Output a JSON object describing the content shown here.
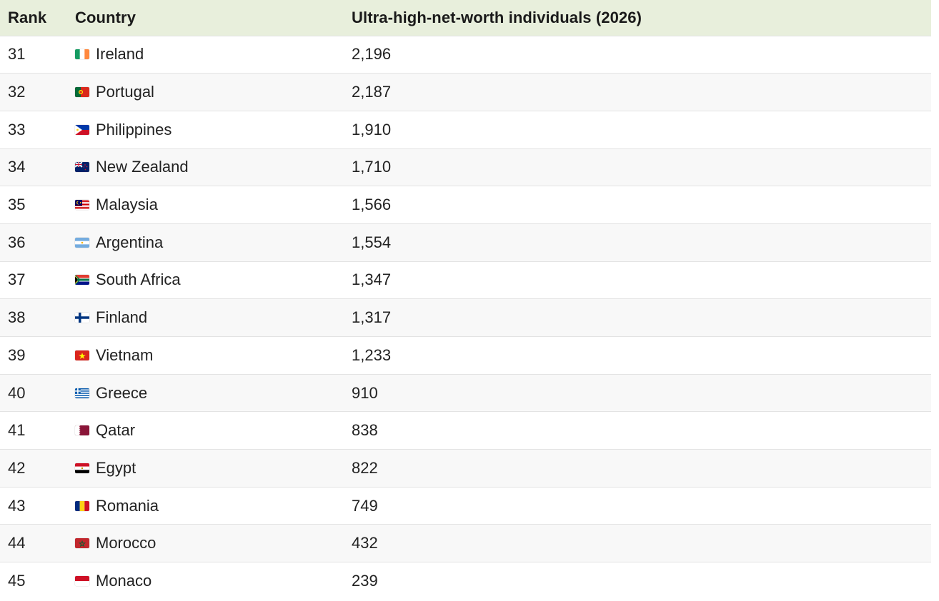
{
  "table": {
    "headers": {
      "rank": "Rank",
      "country": "Country",
      "value": "Ultra-high-net-worth individuals (2026)"
    },
    "rows": [
      {
        "rank": "31",
        "country": "Ireland",
        "value": "2,196",
        "flag_icon": "ireland-flag-icon"
      },
      {
        "rank": "32",
        "country": "Portugal",
        "value": "2,187",
        "flag_icon": "portugal-flag-icon"
      },
      {
        "rank": "33",
        "country": "Philippines",
        "value": "1,910",
        "flag_icon": "philippines-flag-icon"
      },
      {
        "rank": "34",
        "country": "New Zealand",
        "value": "1,710",
        "flag_icon": "new-zealand-flag-icon"
      },
      {
        "rank": "35",
        "country": "Malaysia",
        "value": "1,566",
        "flag_icon": "malaysia-flag-icon"
      },
      {
        "rank": "36",
        "country": "Argentina",
        "value": "1,554",
        "flag_icon": "argentina-flag-icon"
      },
      {
        "rank": "37",
        "country": "South Africa",
        "value": "1,347",
        "flag_icon": "south-africa-flag-icon"
      },
      {
        "rank": "38",
        "country": "Finland",
        "value": "1,317",
        "flag_icon": "finland-flag-icon"
      },
      {
        "rank": "39",
        "country": "Vietnam",
        "value": "1,233",
        "flag_icon": "vietnam-flag-icon"
      },
      {
        "rank": "40",
        "country": "Greece",
        "value": "910",
        "flag_icon": "greece-flag-icon"
      },
      {
        "rank": "41",
        "country": "Qatar",
        "value": "838",
        "flag_icon": "qatar-flag-icon"
      },
      {
        "rank": "42",
        "country": "Egypt",
        "value": "822",
        "flag_icon": "egypt-flag-icon"
      },
      {
        "rank": "43",
        "country": "Romania",
        "value": "749",
        "flag_icon": "romania-flag-icon"
      },
      {
        "rank": "44",
        "country": "Morocco",
        "value": "432",
        "flag_icon": "morocco-flag-icon"
      },
      {
        "rank": "45",
        "country": "Monaco",
        "value": "239",
        "flag_icon": "monaco-flag-icon"
      }
    ]
  },
  "colors": {
    "header_bg": "#e8efdc",
    "row_alt_bg": "#f8f8f8",
    "row_border": "#e3e3e3",
    "text": "#222222"
  }
}
